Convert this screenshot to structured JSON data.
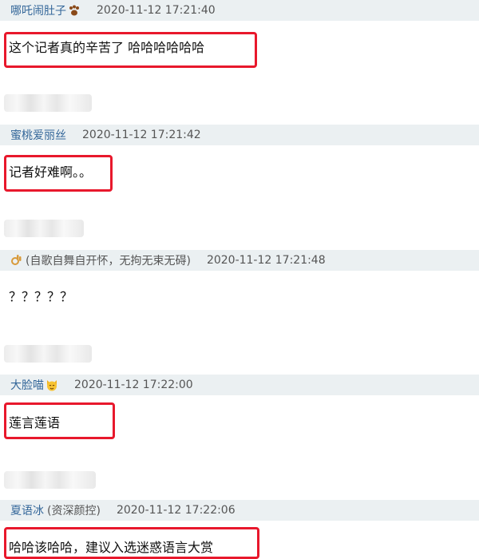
{
  "comments": [
    {
      "username": "哪吒闹肚子",
      "badge": "",
      "timestamp": "2020-11-12 17:21:40",
      "text": "这个记者真的辛苦了 哈哈哈哈哈哈",
      "emoji": "paw-icon"
    },
    {
      "username": "蜜桃爱丽丝",
      "badge": "",
      "timestamp": "2020-11-12 17:21:42",
      "text": "记者好难啊。。",
      "emoji": ""
    },
    {
      "username": "",
      "badge": "(自歌自舞自开怀，无拘无束无碍)",
      "timestamp": "2020-11-12 17:21:48",
      "text": "？？？？？",
      "emoji": "ok-hand-icon"
    },
    {
      "username": "大脸喵",
      "badge": "",
      "timestamp": "2020-11-12 17:22:00",
      "text": "莲言莲语",
      "emoji": "cat-face-icon"
    },
    {
      "username": "夏语冰",
      "badge": "(资深颜控)",
      "timestamp": "2020-11-12 17:22:06",
      "text": "哈哈该哈哈，建议入选迷惑语言大赏",
      "emoji": ""
    }
  ],
  "colors": {
    "header_bg": "#ebf0f2",
    "username": "#336699",
    "highlight": "#e8182c"
  }
}
